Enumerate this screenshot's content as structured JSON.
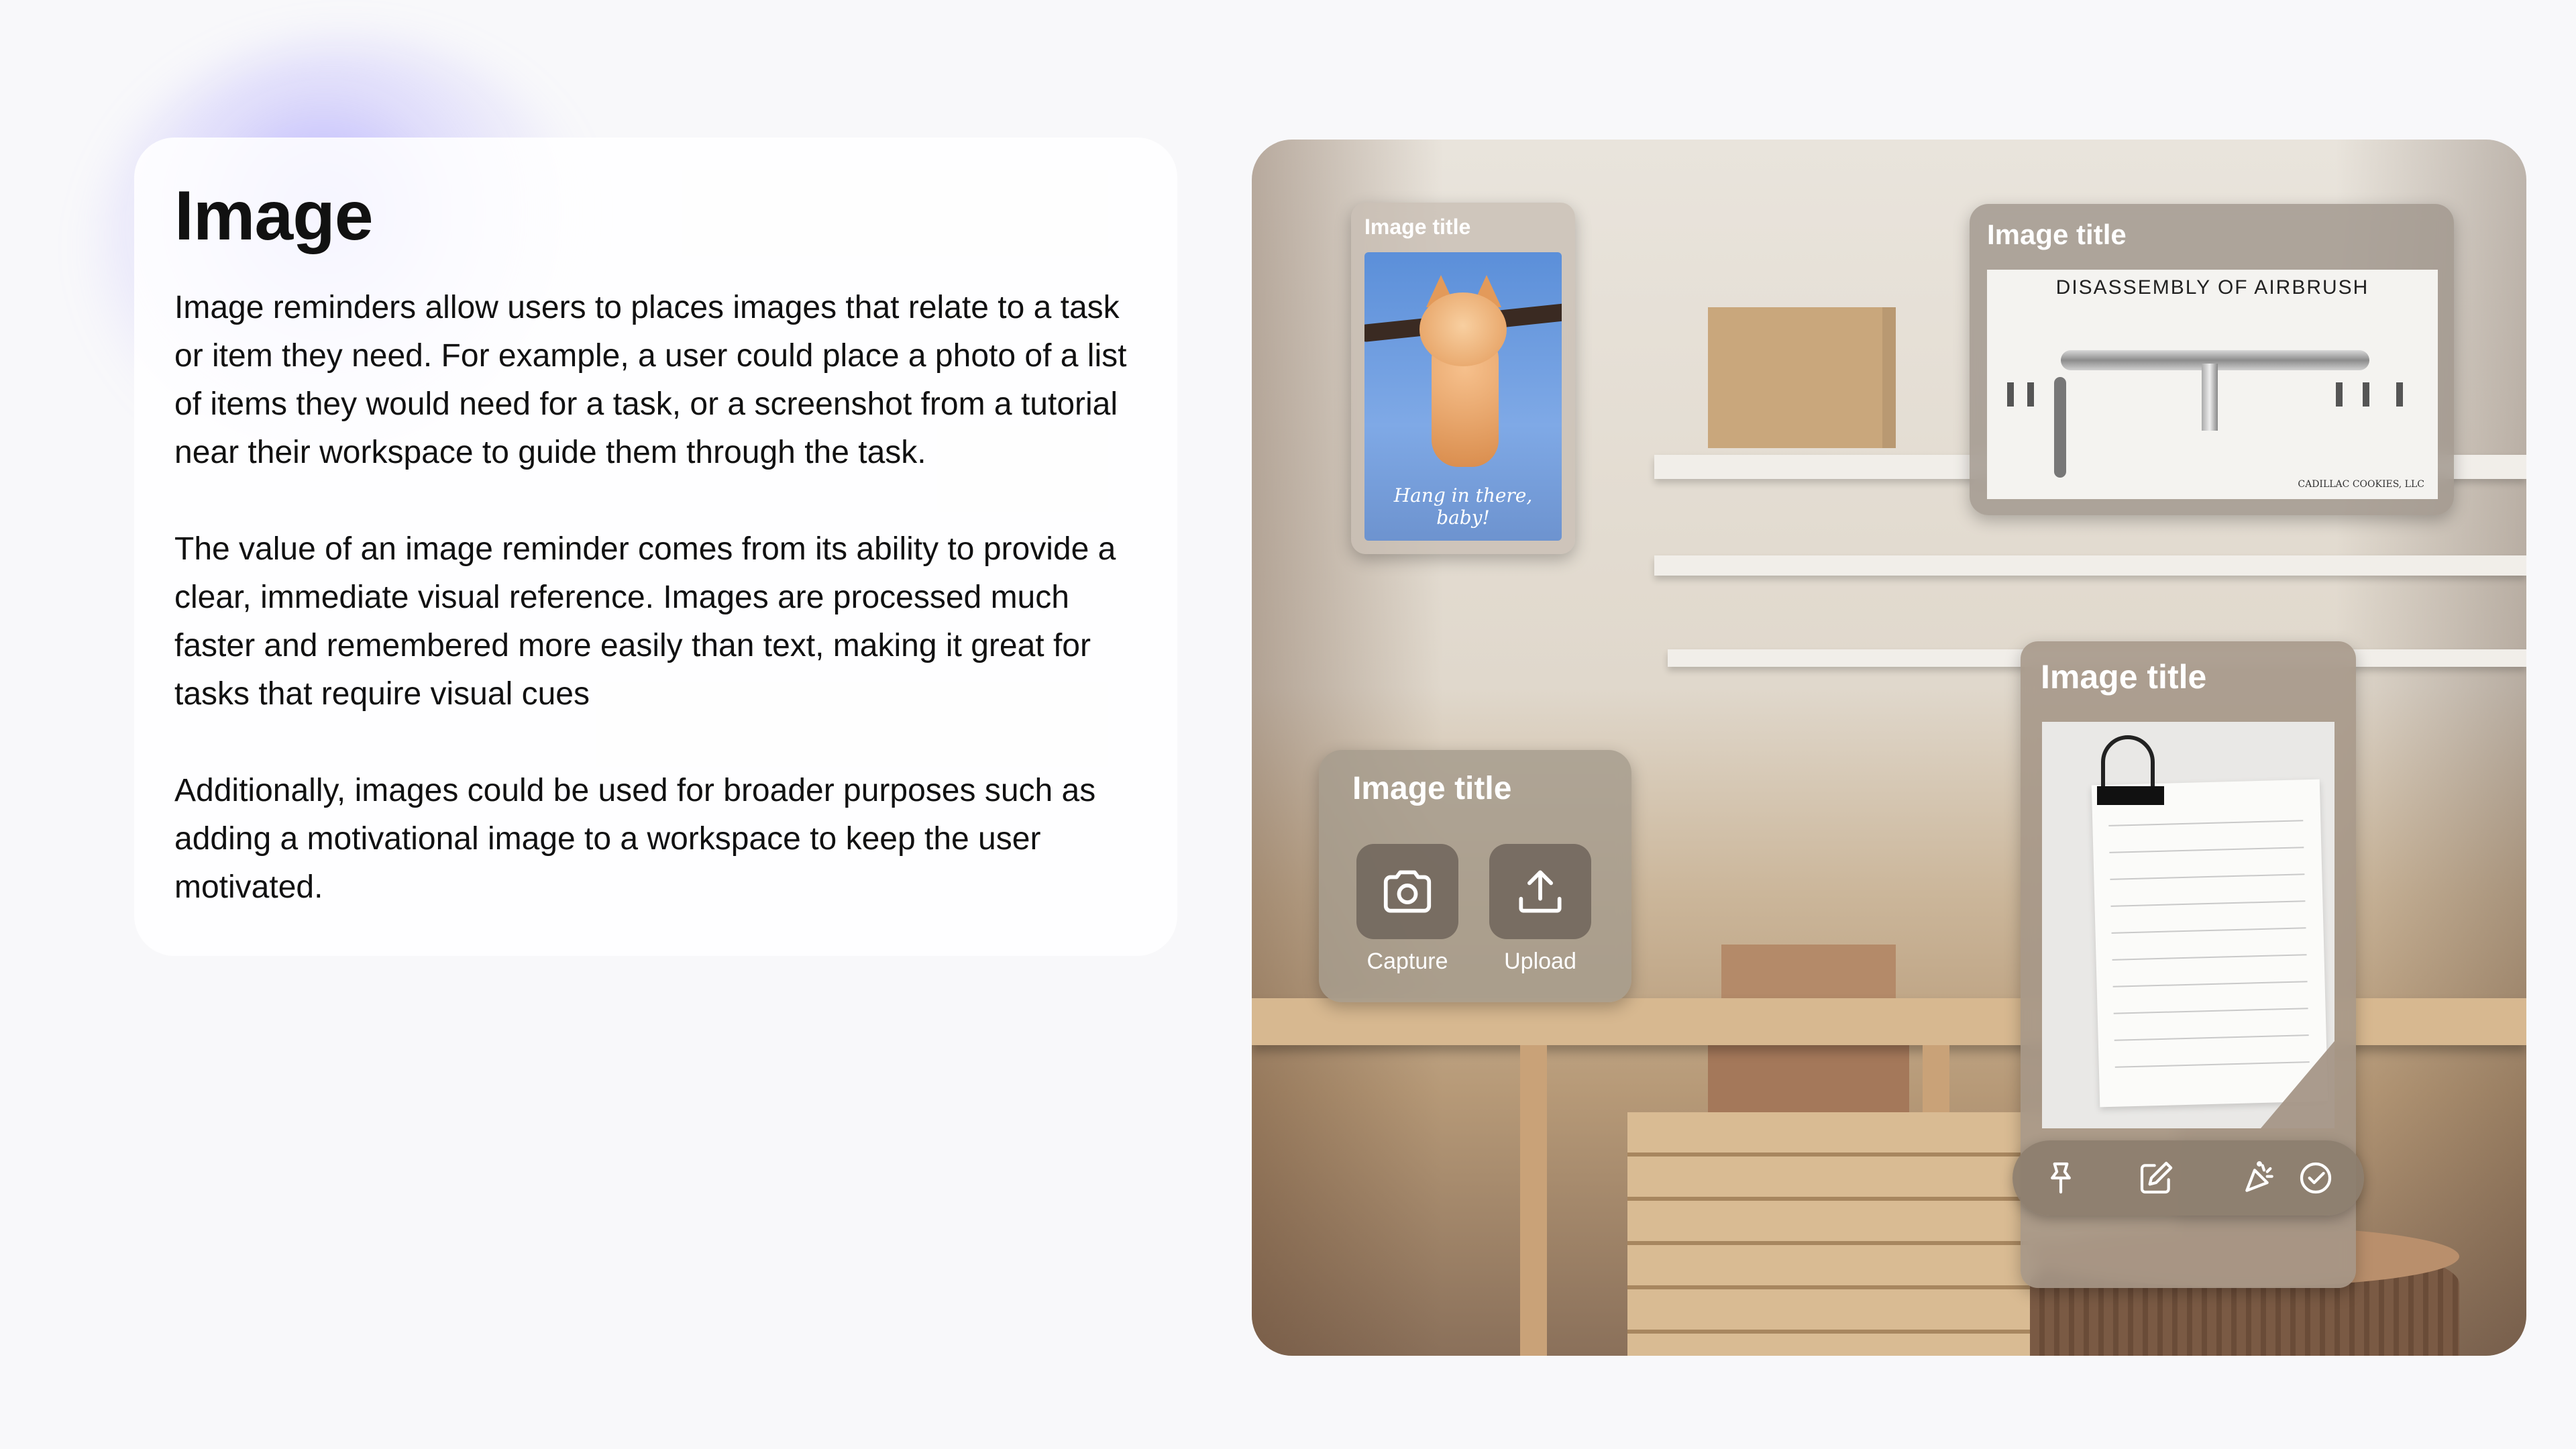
{
  "description_card": {
    "title": "Image",
    "paragraphs": [
      "Image reminders allow users to places images that relate to a task or item they need. For example, a user could place a photo of a list of items they would need for a task, or a screenshot from a tutorial near their workspace to guide them through the task.",
      "The value of an image reminder comes from its ability to provide a clear, immediate visual reference. Images are processed much faster and remembered more easily than text, making it great for tasks that require visual cues",
      "Additionally, images could be used for broader purposes such as adding a motivational image to a workspace to keep the user motivated."
    ]
  },
  "scene": {
    "windows": {
      "kitten": {
        "title": "Image title",
        "image_caption": "Hang in there, baby!"
      },
      "airbrush": {
        "title": "Image title",
        "diagram_heading": "DISASSEMBLY OF AIRBRUSH",
        "diagram_credit": "CADILLAC COOKIES, LLC"
      },
      "notepad": {
        "title": "Image title"
      },
      "upload": {
        "title": "Image title",
        "capture_label": "Capture",
        "upload_label": "Upload"
      }
    },
    "toolbar": {
      "icons": [
        "pin-icon",
        "edit-icon",
        "celebrate-icon",
        "check-circle-icon"
      ]
    }
  },
  "colors": {
    "background": "#f8f8fa",
    "accent_glow": "#8278ff",
    "window_glass": "#a89a8c"
  }
}
